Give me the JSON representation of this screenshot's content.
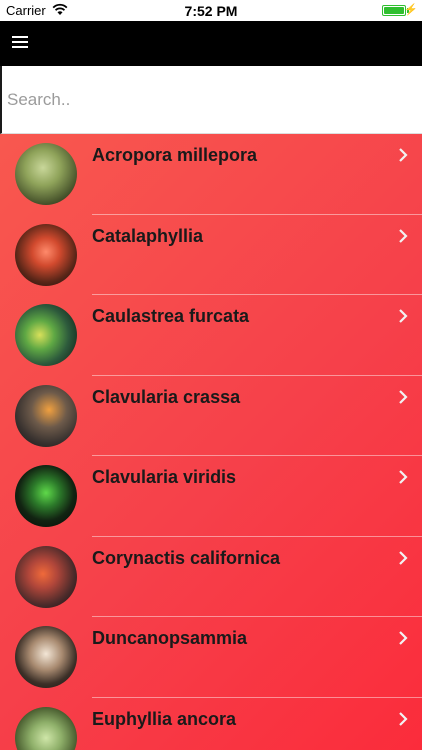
{
  "status": {
    "carrier": "Carrier",
    "time": "7:52 PM"
  },
  "search": {
    "placeholder": "Search.."
  },
  "items": [
    {
      "label": "Acropora millepora",
      "thumb": "radial-gradient(circle at 45% 40%, #c9d79a 0%, #8fa35a 35%, #3f4a26 75%, #1e2613 100%)"
    },
    {
      "label": "Catalaphyllia",
      "thumb": "radial-gradient(circle at 50% 45%, #ff8a6b 0%, #d24a2e 30%, #5a2618 65%, #100806 100%)"
    },
    {
      "label": "Caulastrea furcata",
      "thumb": "radial-gradient(circle at 40% 50%, #d8e05a 0%, #5fa844 30%, #2d5a3c 60%, #0c1410 100%)"
    },
    {
      "label": "Clavularia crassa",
      "thumb": "radial-gradient(circle at 55% 40%, #f0a040 0%, #6d5a4a 35%, #3a3330 65%, #121010 100%)"
    },
    {
      "label": "Clavularia viridis",
      "thumb": "radial-gradient(circle at 50% 45%, #5fd94a 0%, #2c7a2a 30%, #122412 60%, #040604 100%)"
    },
    {
      "label": "Corynactis californica",
      "thumb": "radial-gradient(circle at 45% 45%, #f06a3a 0%, #b0463a 30%, #4a2a2a 65%, #140a0a 100%)"
    },
    {
      "label": "Duncanopsammia",
      "thumb": "radial-gradient(circle at 50% 45%, #f3e6d6 0%, #a88a70 35%, #3c3028 65%, #0f0c0a 100%)"
    },
    {
      "label": "Euphyllia ancora",
      "thumb": "radial-gradient(circle at 50% 50%, #cfe6a8 0%, #8fb06a 35%, #4a5e30 70%, #1f2a14 100%)"
    }
  ]
}
